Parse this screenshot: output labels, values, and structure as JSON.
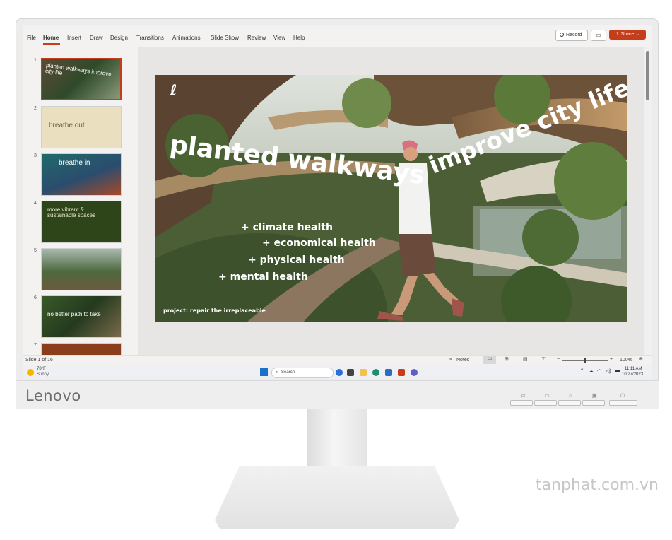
{
  "app": {
    "ribbon_tabs": [
      "File",
      "Home",
      "Insert",
      "Draw",
      "Design",
      "Transitions",
      "Animations",
      "Slide Show",
      "Review",
      "View",
      "Help"
    ],
    "active_tab": "Home",
    "record_label": "Record",
    "share_label": "Share",
    "accent": "#c43e1c"
  },
  "thumbnails": [
    {
      "num": "1",
      "text": "planted walkways  improve city life",
      "selected": true
    },
    {
      "num": "2",
      "text": "breathe out"
    },
    {
      "num": "3",
      "text": "breathe  in"
    },
    {
      "num": "4",
      "text": "more vibrant & sustainable spaces"
    },
    {
      "num": "5",
      "text": ""
    },
    {
      "num": "6",
      "text": "no better path to take"
    },
    {
      "num": "7",
      "text": ""
    }
  ],
  "slide": {
    "headline1": "planted walkways",
    "headline2": "improve city life",
    "bullets": [
      "+ climate health",
      "+ economical health",
      "+ physical health",
      "+ mental health"
    ],
    "footer": "project: repair the irreplaceable"
  },
  "status": {
    "slide_counter": "Slide 1 of 16",
    "notes_label": "Notes",
    "zoom": "100%"
  },
  "taskbar": {
    "weather_temp": "78°F",
    "weather_desc": "Sunny",
    "search_placeholder": "Search",
    "time": "11:11 AM",
    "date": "10/27/2023"
  },
  "monitor": {
    "brand": "Lenovo"
  },
  "watermark": "tanphat.com.vn"
}
